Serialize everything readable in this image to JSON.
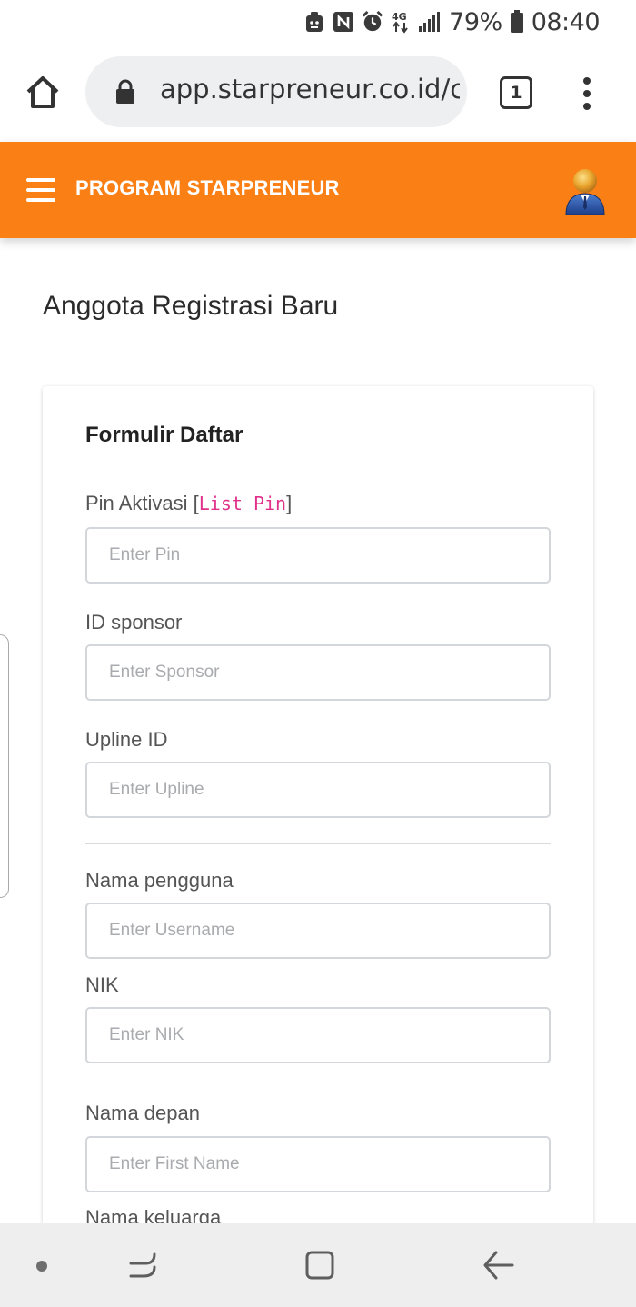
{
  "status_bar": {
    "battery_percent": "79%",
    "time": "08:40",
    "network_label": "4G",
    "icons": [
      "android-system-icon",
      "nfc-icon",
      "alarm-icon",
      "network-4g-icon",
      "signal-icon",
      "battery-icon"
    ]
  },
  "browser": {
    "url": "app.starpreneur.co.id/c",
    "tab_count": "1",
    "icons": [
      "home-icon",
      "lock-icon",
      "tabs-icon",
      "more-vert-icon"
    ]
  },
  "header": {
    "title": "PROGRAM STARPRENEUR",
    "brand_color": "#fa7f15",
    "icons": [
      "hamburger-menu-icon",
      "user-avatar-icon"
    ]
  },
  "page": {
    "title": "Anggota Registrasi Baru"
  },
  "form": {
    "title": "Formulir Daftar",
    "pin": {
      "label": "Pin Aktivasi",
      "bracket_open": "[",
      "link": "List Pin",
      "bracket_close": "]",
      "placeholder": "Enter Pin",
      "value": ""
    },
    "sponsor": {
      "label": "ID sponsor",
      "placeholder": "Enter Sponsor",
      "value": ""
    },
    "upline": {
      "label": "Upline ID",
      "placeholder": "Enter Upline",
      "value": ""
    },
    "username": {
      "label": "Nama pengguna",
      "placeholder": "Enter Username",
      "value": ""
    },
    "nik": {
      "label": "NIK",
      "placeholder": "Enter NIK",
      "value": ""
    },
    "first_name": {
      "label": "Nama depan",
      "placeholder": "Enter First Name",
      "value": ""
    },
    "family_name": {
      "label": "Nama keluarga"
    }
  },
  "nav": {
    "icons": [
      "assistant-dot-icon",
      "recent-apps-icon",
      "home-square-icon",
      "back-arrow-icon"
    ]
  }
}
